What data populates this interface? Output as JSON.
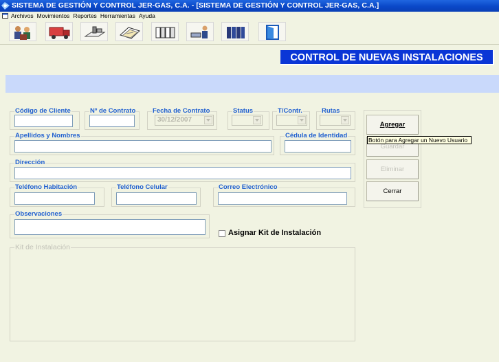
{
  "window": {
    "title": "SISTEMA DE GESTIÓN Y CONTROL JER-GAS, C.A. - [SISTEMA DE GESTIÓN Y CONTROL JER-GAS, C.A.]"
  },
  "menu": [
    "Archivos",
    "Movimientos",
    "Reportes",
    "Herramientas",
    "Ayuda"
  ],
  "toolbar": {
    "icons": [
      "users-icon",
      "truck-icon",
      "installation-icon",
      "documents-icon",
      "files-icon",
      "worker-icon",
      "binders-icon",
      "exit-door-icon"
    ]
  },
  "header": {
    "title": "CONTROL DE NUEVAS INSTALACIONES"
  },
  "form": {
    "codigo_cliente": "Código de Cliente",
    "nro_contrato": "Nº de Contrato",
    "fecha_contrato": "Fecha de Contrato",
    "fecha_contrato_value": "30/12/2007",
    "status": "Status",
    "tipo_contrato": "T/Contr.",
    "rutas": "Rutas",
    "apellidos_nombres": "Apellidos y Nombres",
    "cedula": "Cédula de Identidad",
    "direccion": "Dirección",
    "telefono_habitacion": "Teléfono Habitación",
    "telefono_celular": "Teléfono Celular",
    "correo": "Correo Electrónico",
    "observaciones": "Observaciones",
    "asignar_kit": "Asignar Kit de Instalación",
    "kit_instalacion": "Kit de Instalación"
  },
  "buttons": {
    "agregar": "Agregar",
    "guardar": "Guardar",
    "eliminar": "Eliminar",
    "cerrar": "Cerrar"
  },
  "tooltip": "Botón para Agregar un Nuevo Usuario"
}
